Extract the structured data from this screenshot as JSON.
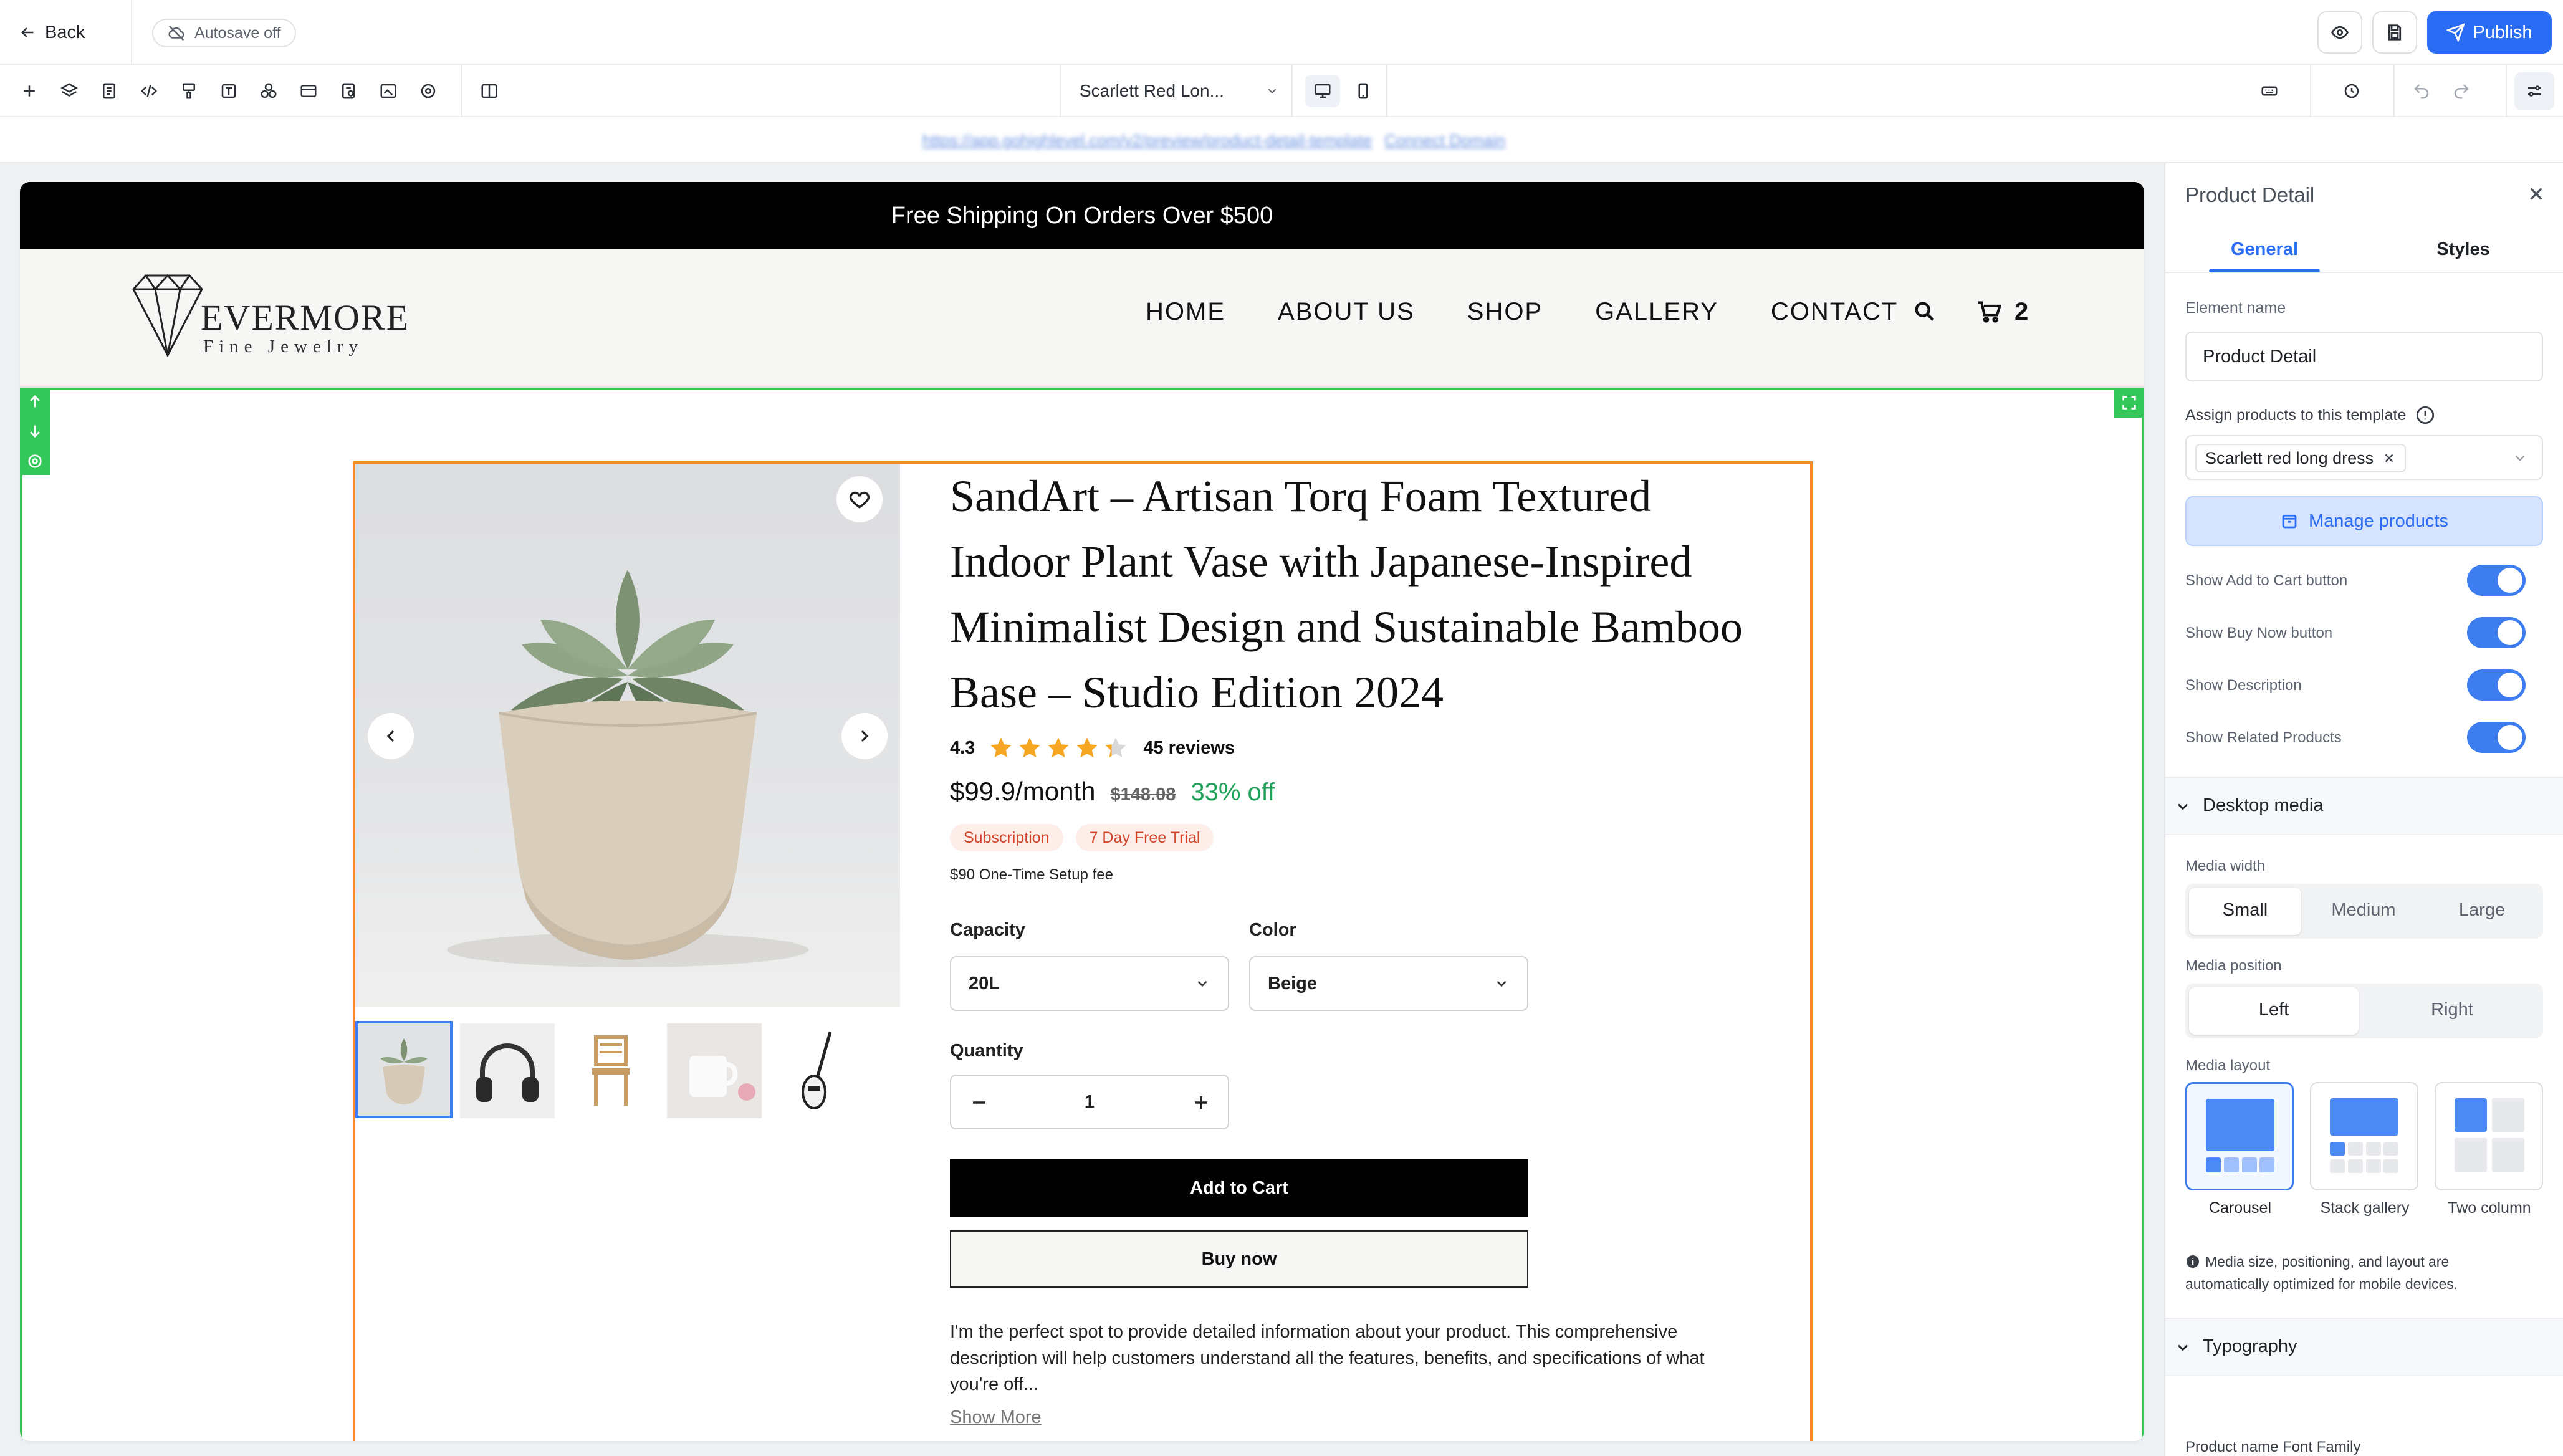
{
  "topbar": {
    "back_label": "Back",
    "autosave_label": "Autosave off",
    "publish_label": "Publish"
  },
  "toolbar": {
    "page_selector": "Scarlett Red Lon..."
  },
  "urlbar": {
    "url": "https://app.gohighlevel.com/v2/preview/product-detail-template",
    "connect_domain": "Connect Domain"
  },
  "store": {
    "announcement": "Free Shipping On Orders Over $500",
    "brand": {
      "name": "EVERMORE",
      "tagline": "Fine Jewelry"
    },
    "nav": [
      "HOME",
      "ABOUT US",
      "SHOP",
      "GALLERY",
      "CONTACT"
    ],
    "cart_count": "2"
  },
  "product": {
    "title_lines": [
      "SandArt – Artisan Torq Foam Textured",
      "Indoor Plant Vase with Japanese-Inspired",
      "Minimalist Design and Sustainable Bamboo",
      "Base – Studio Edition 2024"
    ],
    "rating": 4.3,
    "rating_text": "4.3",
    "reviews": "45 reviews",
    "price": "$99.9/month",
    "old_price": "$148.08",
    "discount": "33% off",
    "badges": [
      "Subscription",
      "7 Day Free Trial"
    ],
    "setup_fee": "$90 One-Time Setup fee",
    "capacity_label": "Capacity",
    "capacity_value": "20L",
    "color_label": "Color",
    "color_value": "Beige",
    "quantity_label": "Quantity",
    "quantity_value": "1",
    "add_to_cart": "Add to Cart",
    "buy_now": "Buy now",
    "description_lines": [
      "I'm the perfect spot to provide detailed information about your product. This comprehensive",
      "description will help customers understand all the features, benefits, and specifications of what",
      "you're off..."
    ],
    "show_more": "Show More"
  },
  "panel": {
    "title": "Product Detail",
    "tabs": [
      "General",
      "Styles"
    ],
    "element_name_label": "Element name",
    "element_name_value": "Product Detail",
    "assign_label": "Assign products to this template",
    "assigned_chip": "Scarlett red long dress",
    "manage_products": "Manage products",
    "toggles": [
      {
        "label": "Show Add to Cart button",
        "on": true
      },
      {
        "label": "Show Buy Now button",
        "on": true
      },
      {
        "label": "Show Description",
        "on": true
      },
      {
        "label": "Show Related Products",
        "on": true
      }
    ],
    "desktop_media": "Desktop media",
    "media_width_label": "Media width",
    "media_width_options": [
      "Small",
      "Medium",
      "Large"
    ],
    "media_width_selected": "Small",
    "media_position_label": "Media position",
    "media_position_options": [
      "Left",
      "Right"
    ],
    "media_position_selected": "Left",
    "media_layout_label": "Media layout",
    "media_layout_options": [
      "Carousel",
      "Stack gallery",
      "Two column"
    ],
    "media_layout_selected": "Carousel",
    "media_note_lines": [
      "Media size, positioning, and layout are",
      "automatically optimized for mobile devices."
    ],
    "typography": "Typography",
    "font_family_label": "Product name Font Family"
  },
  "colors": {
    "accent": "#3d7df0",
    "selection_green": "#34c759",
    "selection_orange": "#f28c28",
    "star": "#f5a623",
    "discount_green": "#1fa35b",
    "badge_red": "#d0452b"
  }
}
